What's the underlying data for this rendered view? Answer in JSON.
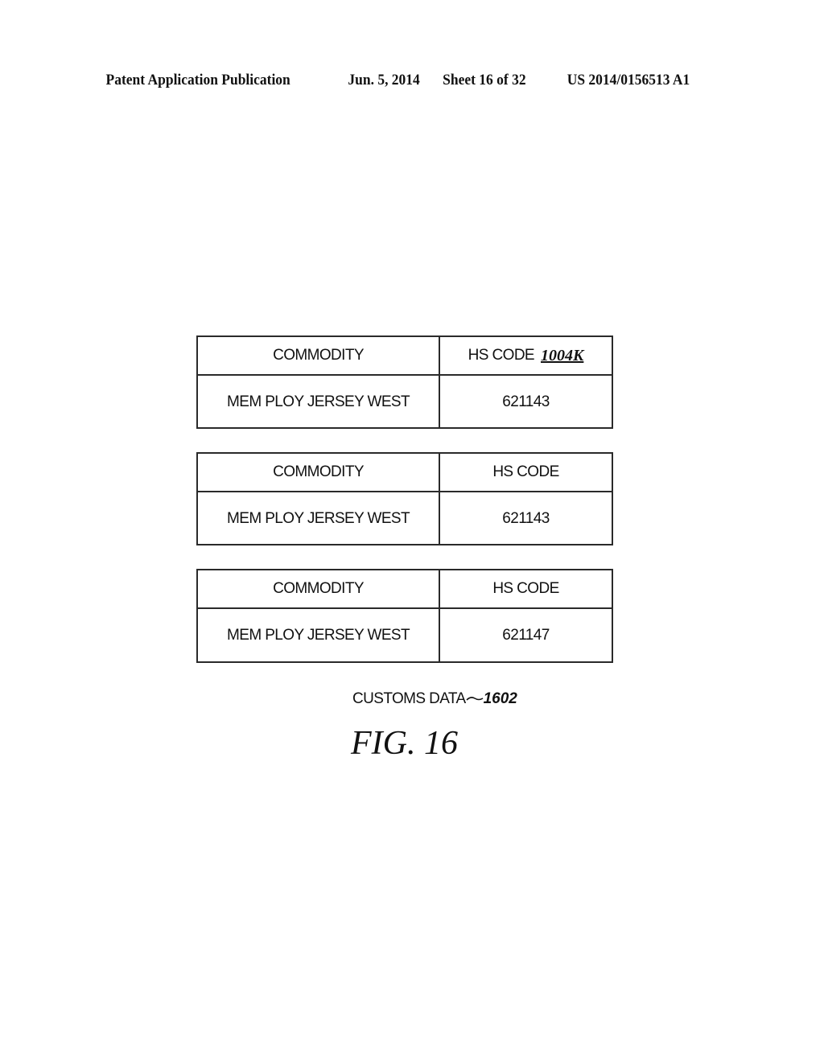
{
  "header": {
    "publication": "Patent Application Publication",
    "date": "Jun. 5, 2014",
    "sheet": "Sheet 16 of 32",
    "number": "US 2014/0156513 A1"
  },
  "tables": [
    {
      "headers": [
        "COMMODITY",
        "HS CODE"
      ],
      "header_ref": "1004K",
      "rows": [
        [
          "MEM PLOY JERSEY WEST",
          "621143"
        ]
      ]
    },
    {
      "headers": [
        "COMMODITY",
        "HS CODE"
      ],
      "rows": [
        [
          "MEM PLOY JERSEY WEST",
          "621143"
        ]
      ]
    },
    {
      "headers": [
        "COMMODITY",
        "HS CODE"
      ],
      "rows": [
        [
          "MEM PLOY JERSEY WEST",
          "621147"
        ]
      ]
    }
  ],
  "caption": {
    "label": "CUSTOMS DATA",
    "ref": "1602"
  },
  "figure_label": "FIG. 16"
}
